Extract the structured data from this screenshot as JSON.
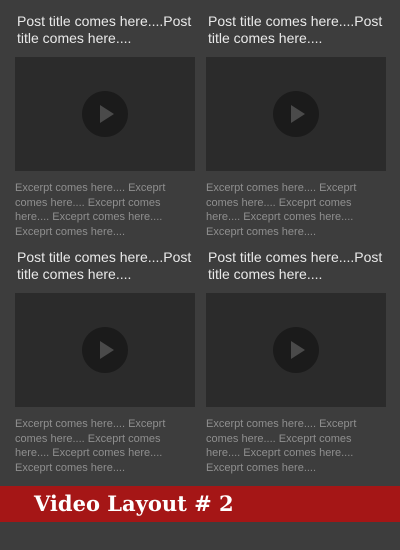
{
  "posts": [
    {
      "title": "Post title comes here....Post title comes here....",
      "excerpt": "Excerpt comes here.... Exceprt comes here.... Exceprt comes here.... Exceprt comes here.... Exceprt comes here...."
    },
    {
      "title": "Post title comes here....Post title comes here....",
      "excerpt": "Excerpt comes here.... Exceprt comes here.... Exceprt comes here.... Exceprt comes here.... Exceprt comes here...."
    },
    {
      "title": "Post title comes here....Post title comes here....",
      "excerpt": "Excerpt comes here.... Exceprt comes here.... Exceprt comes here.... Exceprt comes here.... Exceprt comes here...."
    },
    {
      "title": "Post title comes here....Post title comes here....",
      "excerpt": "Excerpt comes here.... Exceprt comes here.... Exceprt comes here.... Exceprt comes here.... Exceprt comes here...."
    }
  ],
  "banner": {
    "title": "Video Layout # 2"
  },
  "icons": {
    "play": "play-icon"
  },
  "colors": {
    "background": "#3d3d3d",
    "video_placeholder": "#2b2b2b",
    "play_circle": "#1b1b1b",
    "play_triangle": "#4a4a4a",
    "banner": "#a51616",
    "title_text": "#e9e9e9",
    "excerpt_text": "#8f8f8f"
  }
}
